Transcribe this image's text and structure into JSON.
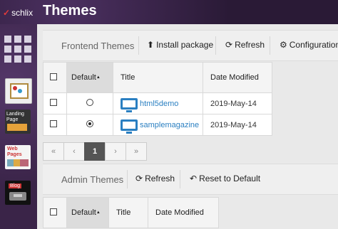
{
  "header": {
    "logo_mark": "✓",
    "logo_text": "schlix",
    "title": "Themes"
  },
  "sidebar": {
    "items": [
      {
        "name": "Landing Page"
      },
      {
        "name": "Web Pages"
      },
      {
        "name": "Blog"
      }
    ],
    "tile2_text": "Landing\nPage",
    "tile3_text": "Web\nPages",
    "tile4_text": "Blog"
  },
  "frontend": {
    "title": "Frontend Themes",
    "install_label": "Install package",
    "refresh_label": "Refresh",
    "config_label": "Configuration",
    "columns": {
      "default": "Default",
      "title": "Title",
      "date": "Date Modified"
    },
    "rows": [
      {
        "title": "html5demo",
        "date": "2019-May-14",
        "default": false
      },
      {
        "title": "samplemagazine",
        "date": "2019-May-14",
        "default": true
      }
    ],
    "pager": {
      "first": "«",
      "prev": "‹",
      "current": "1",
      "next": "›",
      "last": "»"
    }
  },
  "admin": {
    "title": "Admin Themes",
    "refresh_label": "Refresh",
    "reset_label": "Reset to Default",
    "columns": {
      "default": "Default",
      "title": "Title",
      "date": "Date Modified"
    }
  },
  "colors": {
    "accent": "#2a7fc1",
    "topbar": "#2a1a36"
  }
}
